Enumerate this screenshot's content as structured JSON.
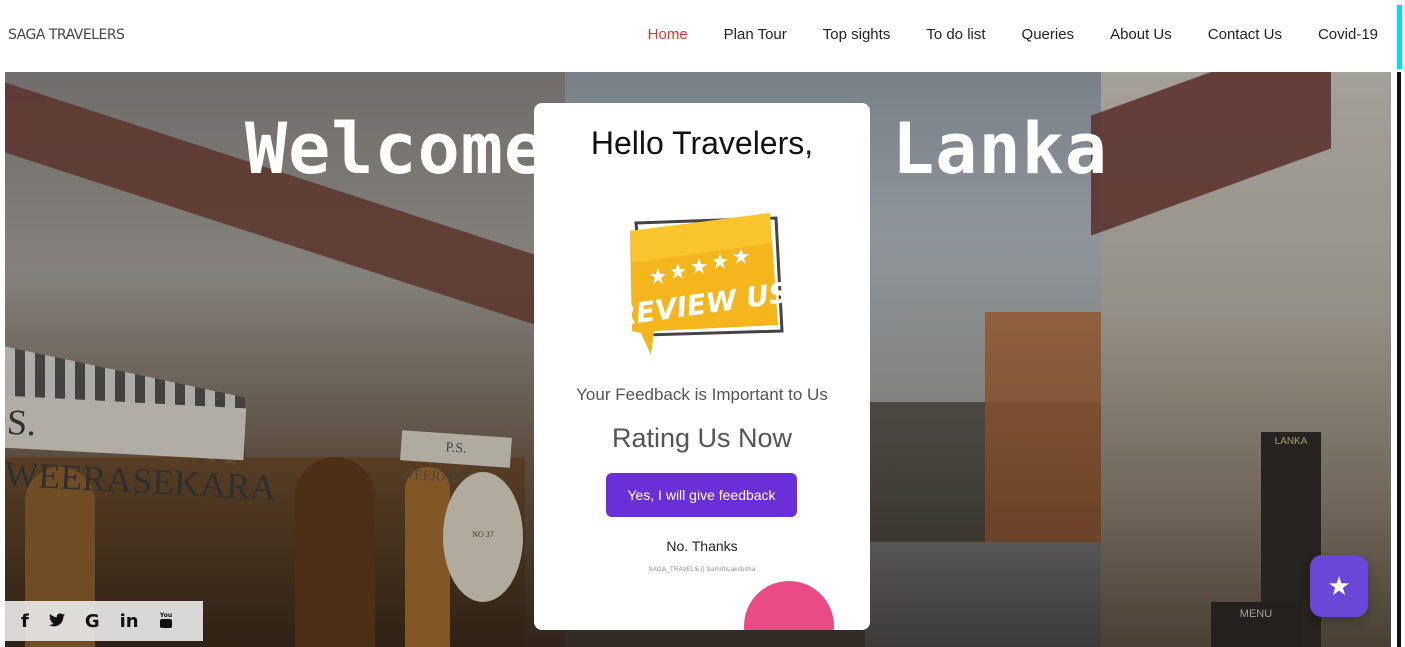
{
  "brand": "SAGA TRAVELERS",
  "nav": [
    {
      "label": "Home",
      "active": true
    },
    {
      "label": "Plan Tour",
      "active": false
    },
    {
      "label": "Top sights",
      "active": false
    },
    {
      "label": "To do list",
      "active": false
    },
    {
      "label": "Queries",
      "active": false
    },
    {
      "label": "About Us",
      "active": false
    },
    {
      "label": "Contact Us",
      "active": false
    },
    {
      "label": "Covid-19",
      "active": false
    }
  ],
  "hero": {
    "headline": "Welcome to Sri Lanka",
    "sign_large": "S. WEERASEKARA",
    "sign_small": "P.S. WEERASEKARA",
    "shop_sign": "NO 37",
    "menu_board": "LANKA",
    "menu_board2": "MENU"
  },
  "modal": {
    "title": "Hello Travelers,",
    "badge_text": "REVIEW US!",
    "subtitle": "Your Feedback is Important to Us",
    "rating_prompt": "Rating Us Now",
    "primary_button": "Yes, I will give feedback",
    "secondary_link": "No. Thanks",
    "credit": "SAGA_TRAVELS || SamithLakshitha"
  },
  "social": [
    {
      "icon": "facebook-icon",
      "glyph": "f"
    },
    {
      "icon": "twitter-icon",
      "glyph": "🐦"
    },
    {
      "icon": "google-icon",
      "glyph": "G"
    },
    {
      "icon": "linkedin-icon",
      "glyph": "in"
    },
    {
      "icon": "youtube-icon",
      "glyph": "You"
    }
  ],
  "fab": {
    "icon": "star-icon",
    "glyph": "★"
  },
  "colors": {
    "nav_active": "#e8342a",
    "button_primary": "#6a2fd8",
    "fab": "#6a47d6",
    "badge_yellow": "#f5b51c",
    "deco_pink": "#ea4b86",
    "scroll_accent": "#00e0e8"
  }
}
